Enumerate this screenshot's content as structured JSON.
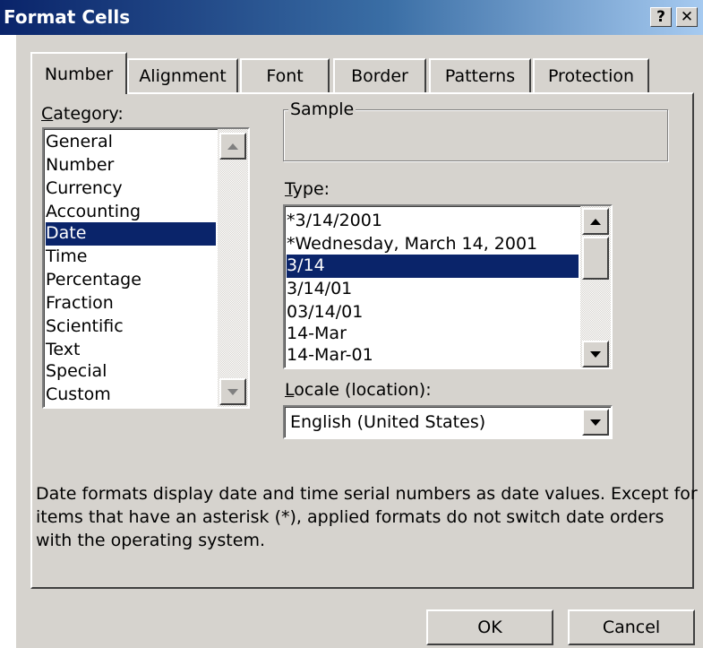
{
  "window": {
    "title": "Format Cells",
    "help_label": "?",
    "close_label": "✕"
  },
  "tabs": [
    {
      "label": "Number",
      "active": true
    },
    {
      "label": "Alignment",
      "active": false
    },
    {
      "label": "Font",
      "active": false
    },
    {
      "label": "Border",
      "active": false
    },
    {
      "label": "Patterns",
      "active": false
    },
    {
      "label": "Protection",
      "active": false
    }
  ],
  "category": {
    "label_accel": "C",
    "label_rest": "ategory:",
    "items": [
      "General",
      "Number",
      "Currency",
      "Accounting",
      "Date",
      "Time",
      "Percentage",
      "Fraction",
      "Scientific",
      "Text",
      "Special",
      "Custom"
    ],
    "selected": "Date"
  },
  "sample": {
    "label": "Sample",
    "value": ""
  },
  "type": {
    "label_accel": "T",
    "label_rest": "ype:",
    "items": [
      "*3/14/2001",
      "*Wednesday, March 14, 2001",
      "3/14",
      "3/14/01",
      "03/14/01",
      "14-Mar",
      "14-Mar-01"
    ],
    "selected": "3/14"
  },
  "locale": {
    "label_accel": "L",
    "label_rest": "ocale (location):",
    "value": "English (United States)"
  },
  "description": "Date formats display date and time serial numbers as date values. Except for items that have an asterisk (*), applied formats do not switch date orders with the operating system.",
  "buttons": {
    "ok": "OK",
    "cancel": "Cancel"
  },
  "colors": {
    "face": "#d6d3ce",
    "selection": "#0a246a",
    "title_gradient_start": "#0a246a",
    "title_gradient_end": "#a6caf0"
  }
}
